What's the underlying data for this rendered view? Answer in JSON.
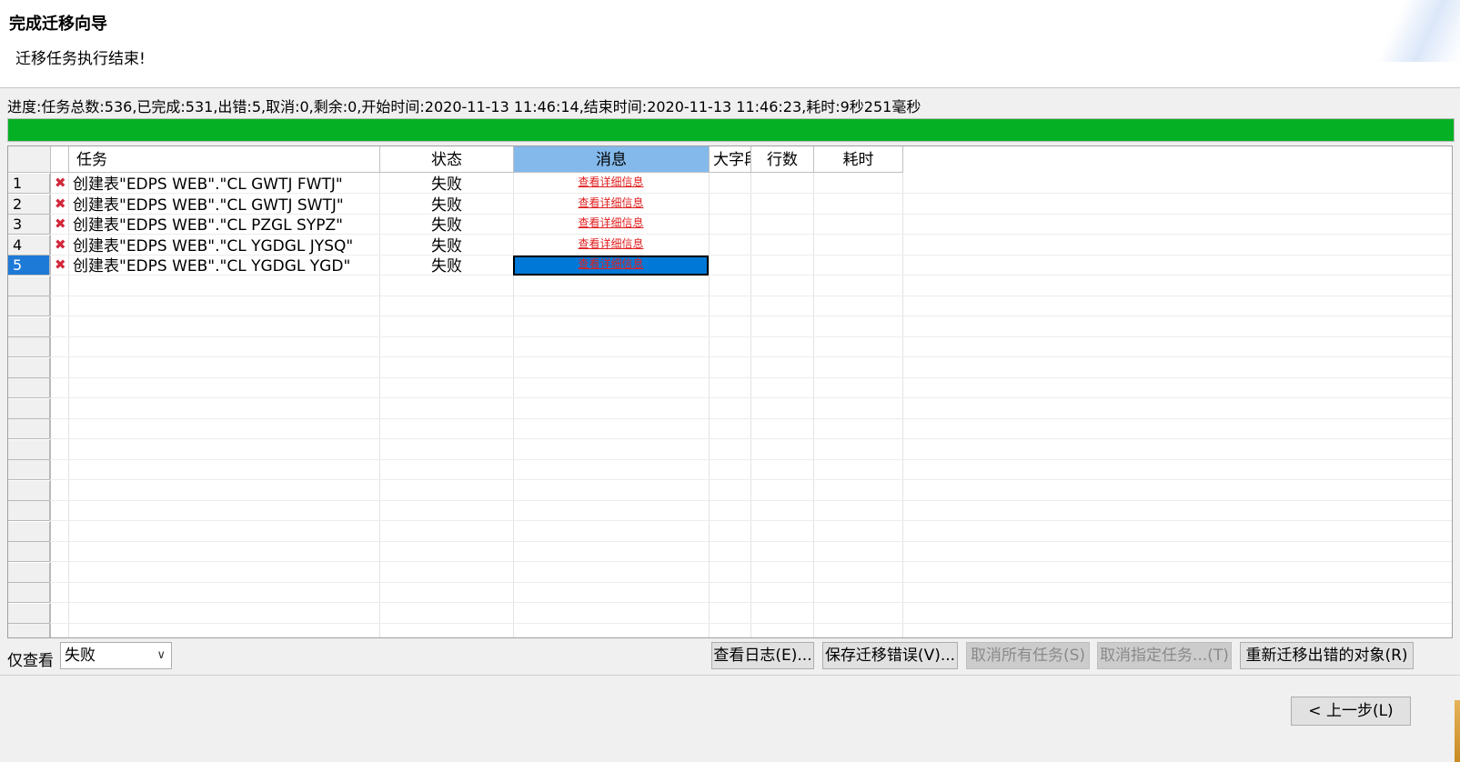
{
  "header": {
    "title": "完成迁移向导",
    "subtitle": "迁移任务执行结束!"
  },
  "progress": {
    "text": "进度:任务总数:536,已完成:531,出错:5,取消:0,剩余:0,开始时间:2020-11-13 11:46:14,结束时间:2020-11-13 11:46:23,耗时:9秒251毫秒",
    "percent": 100,
    "color": "#06b025"
  },
  "grid": {
    "columns": {
      "task": "任务",
      "status": "状态",
      "message": "消息",
      "big": "大字段",
      "rows": "行数",
      "time": "耗时"
    },
    "rows": [
      {
        "num": "1",
        "task": "创建表\"EDPS WEB\".\"CL GWTJ FWTJ\"",
        "status": "失败",
        "message": "查看详细信息"
      },
      {
        "num": "2",
        "task": "创建表\"EDPS WEB\".\"CL GWTJ SWTJ\"",
        "status": "失败",
        "message": "查看详细信息"
      },
      {
        "num": "3",
        "task": "创建表\"EDPS WEB\".\"CL PZGL SYPZ\"",
        "status": "失败",
        "message": "查看详细信息"
      },
      {
        "num": "4",
        "task": "创建表\"EDPS WEB\".\"CL YGDGL JYSQ\"",
        "status": "失败",
        "message": "查看详细信息"
      },
      {
        "num": "5",
        "task": "创建表\"EDPS WEB\".\"CL YGDGL YGD\"",
        "status": "失败",
        "message": "查看详细信息"
      }
    ],
    "selected_row": 5,
    "status_icon": "error-x-icon",
    "status_icon_color": "#d3273a"
  },
  "toolbar": {
    "filter_label": "仅查看",
    "filter_value": "失败",
    "view_log": "查看日志(E)...",
    "save_errors": "保存迁移错误(V)...",
    "cancel_all": "取消所有任务(S)",
    "cancel_selected": "取消指定任务...(T)",
    "retry_failed": "重新迁移出错的对象(R)"
  },
  "footer": {
    "back": "< 上一步(L)"
  }
}
